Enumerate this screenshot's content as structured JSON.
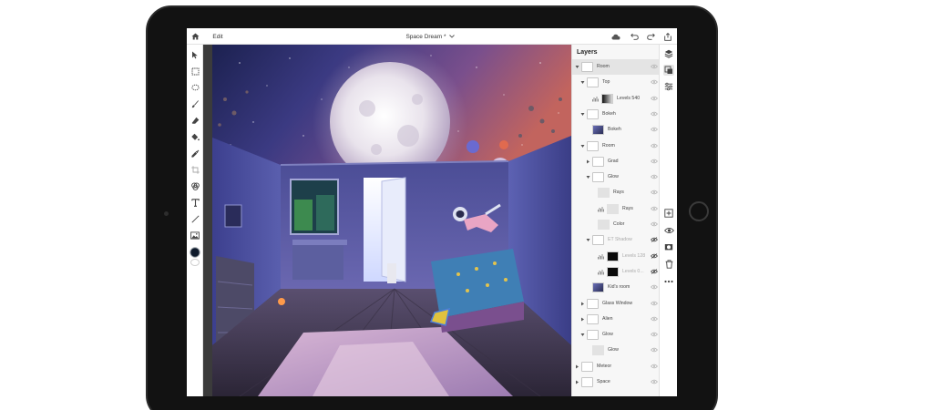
{
  "topbar": {
    "edit_label": "Edit",
    "doc_title": "Space Dream *"
  },
  "icons": {
    "home": "home-icon",
    "cloud": "cloud-icon",
    "undo": "undo-icon",
    "redo": "redo-icon",
    "share": "share-icon"
  },
  "tools": [
    {
      "name": "select-tool-icon"
    },
    {
      "name": "marquee-tool-icon"
    },
    {
      "name": "lasso-tool-icon"
    },
    {
      "name": "brush-tool-icon"
    },
    {
      "name": "eraser-tool-icon"
    },
    {
      "name": "fill-tool-icon"
    },
    {
      "name": "eyedropper-tool-icon"
    },
    {
      "name": "crop-tool-icon"
    },
    {
      "name": "healing-tool-icon"
    },
    {
      "name": "type-tool-icon"
    },
    {
      "name": "line-tool-icon"
    },
    {
      "name": "image-tool-icon"
    },
    {
      "name": "color-swatch"
    }
  ],
  "colors": {
    "foreground_swatch": "#0e1a2b",
    "canvas_sky_left": "#26306b",
    "canvas_sky_right": "#b0555d"
  },
  "layers": {
    "title": "Layers",
    "items": [
      {
        "label": "Room",
        "indent": 0,
        "chevron": "down",
        "thumb": "folder",
        "eye": "on",
        "selected": true
      },
      {
        "label": "Top",
        "indent": 1,
        "chevron": "down",
        "thumb": "folder",
        "eye": "on"
      },
      {
        "label": "Levels 540",
        "indent": 2,
        "chevron": "",
        "thumb": "gradient",
        "eye": "on",
        "adj": true
      },
      {
        "label": "Bokeh",
        "indent": 1,
        "chevron": "down",
        "thumb": "folder",
        "eye": "on"
      },
      {
        "label": "Bokeh",
        "indent": 2,
        "chevron": "",
        "thumb": "image",
        "eye": "on"
      },
      {
        "label": "Room",
        "indent": 1,
        "chevron": "down",
        "thumb": "folder",
        "eye": "on"
      },
      {
        "label": "Grad",
        "indent": 2,
        "chevron": "right",
        "thumb": "folder",
        "eye": "on"
      },
      {
        "label": "Glow",
        "indent": 2,
        "chevron": "down",
        "thumb": "folder",
        "eye": "on"
      },
      {
        "label": "Rays",
        "indent": 3,
        "chevron": "",
        "thumb": "light",
        "eye": "on"
      },
      {
        "label": "Rays",
        "indent": 3,
        "chevron": "",
        "thumb": "light",
        "eye": "on",
        "adj": true
      },
      {
        "label": "Color",
        "indent": 3,
        "chevron": "",
        "thumb": "light",
        "eye": "on"
      },
      {
        "label": "ET Shadow",
        "indent": 2,
        "chevron": "down",
        "thumb": "folder",
        "eye": "off",
        "dim": true
      },
      {
        "label": "Levels 128",
        "indent": 3,
        "chevron": "",
        "thumb": "black",
        "eye": "off",
        "dim": true,
        "adj": true
      },
      {
        "label": "Levels 0...",
        "indent": 3,
        "chevron": "",
        "thumb": "black",
        "eye": "off",
        "dim": true,
        "adj": true
      },
      {
        "label": "Kid's room",
        "indent": 2,
        "chevron": "",
        "thumb": "image",
        "eye": "on"
      },
      {
        "label": "Glass Window",
        "indent": 1,
        "chevron": "right",
        "thumb": "folder",
        "eye": "on"
      },
      {
        "label": "Alien",
        "indent": 1,
        "chevron": "right",
        "thumb": "folder",
        "eye": "on"
      },
      {
        "label": "Glow",
        "indent": 1,
        "chevron": "down",
        "thumb": "folder",
        "eye": "on"
      },
      {
        "label": "Glow",
        "indent": 2,
        "chevron": "",
        "thumb": "light",
        "eye": "on"
      },
      {
        "label": "Meteor",
        "indent": 0,
        "chevron": "right",
        "thumb": "folder",
        "eye": "on"
      },
      {
        "label": "Space",
        "indent": 0,
        "chevron": "right",
        "thumb": "folder",
        "eye": "on"
      }
    ]
  },
  "rightrail": [
    {
      "name": "layers-stack-icon"
    },
    {
      "name": "layer-properties-icon"
    },
    {
      "name": "adjustments-icon"
    },
    {
      "name": "add-layer-icon"
    },
    {
      "name": "visibility-icon"
    },
    {
      "name": "mask-icon"
    },
    {
      "name": "delete-layer-icon"
    },
    {
      "name": "more-options-icon"
    }
  ]
}
